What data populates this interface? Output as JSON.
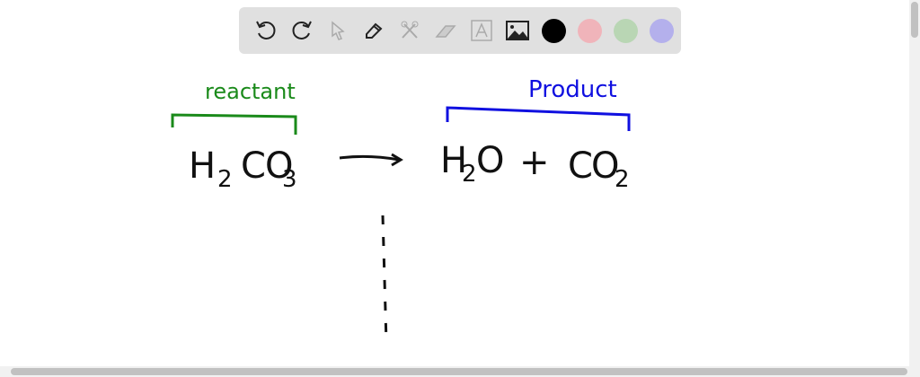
{
  "toolbar": {
    "tools": [
      "undo-icon",
      "redo-icon",
      "pointer-icon",
      "pen-icon",
      "tools-icon",
      "eraser-icon",
      "text-icon",
      "image-icon"
    ],
    "colors": [
      "#000000",
      "#f0b4ba",
      "#b9d6b4",
      "#b4b0ec"
    ]
  },
  "canvas": {
    "reactant_label": "reactant",
    "product_label": "Product",
    "reactant_color": "#1a8a1a",
    "product_color": "#1010e0",
    "reactant": {
      "H": "H",
      "sub1": "2",
      "C": "C",
      "O": "O",
      "sub2": "3"
    },
    "product1": {
      "H": "H",
      "sub1": "2",
      "O": "O"
    },
    "plus": "+",
    "product2": {
      "C": "C",
      "O": "O",
      "sub": "2"
    }
  }
}
